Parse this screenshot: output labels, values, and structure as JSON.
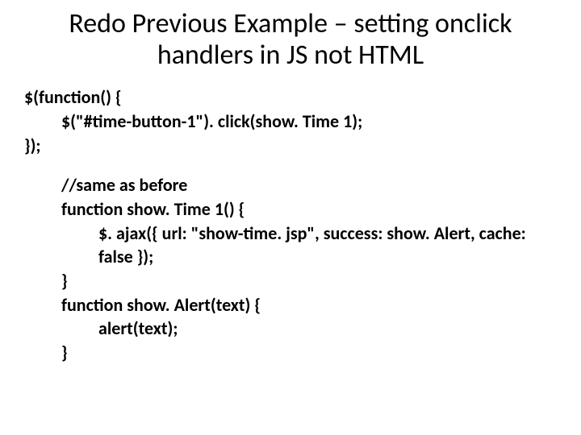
{
  "title": "Redo Previous Example – setting onclick handlers in JS not HTML",
  "lines": {
    "l1": "$(function() {",
    "l2": "$(\"#time-button-1\"). click(show. Time 1);",
    "l3": "});",
    "l4": "//same as before",
    "l5": "function show. Time 1() {",
    "l6": "$. ajax({ url: \"show-time. jsp\", success: show. Alert, cache: false });",
    "l7": "}",
    "l8": "function show. Alert(text) {",
    "l9": "alert(text);",
    "l10": "}"
  }
}
